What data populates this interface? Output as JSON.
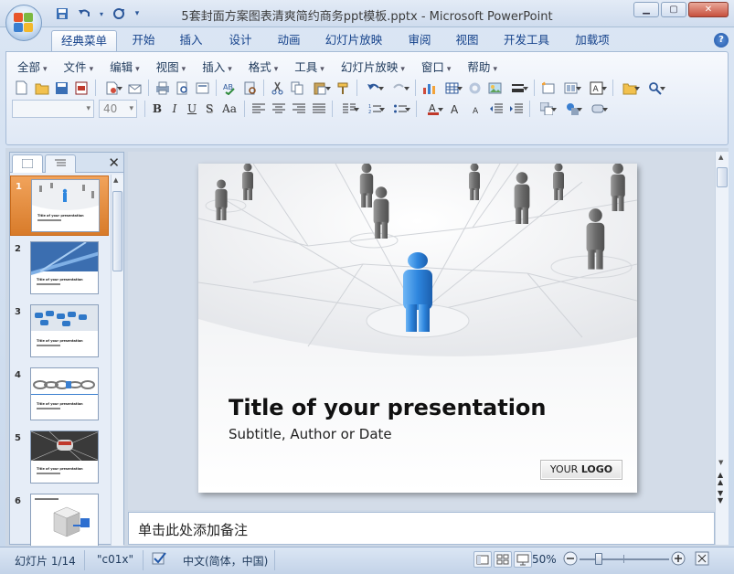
{
  "window": {
    "title": "5套封面方案图表清爽简约商务ppt模板.pptx - Microsoft PowerPoint"
  },
  "tabs": [
    "经典菜单",
    "开始",
    "插入",
    "设计",
    "动画",
    "幻灯片放映",
    "审阅",
    "视图",
    "开发工具",
    "加载项"
  ],
  "menus": [
    "全部",
    "文件",
    "编辑",
    "视图",
    "插入",
    "格式",
    "工具",
    "幻灯片放映",
    "窗口",
    "帮助"
  ],
  "font": {
    "name": "",
    "size": "40"
  },
  "format_buttons": {
    "bold": "B",
    "italic": "I",
    "underline": "U",
    "shadow": "S",
    "case": "Aa"
  },
  "thumbnails": [
    {
      "num": "1",
      "theme": "people",
      "text": "Title of your presentation"
    },
    {
      "num": "2",
      "theme": "blue",
      "text": "Title of your presentation"
    },
    {
      "num": "3",
      "theme": "cables",
      "text": "Title of your presentation"
    },
    {
      "num": "4",
      "theme": "chain",
      "text": "Title of your presentation"
    },
    {
      "num": "5",
      "theme": "train",
      "text": "Title of your presentation"
    },
    {
      "num": "6",
      "theme": "cubes",
      "text": ""
    }
  ],
  "slide": {
    "title": "Title of your presentation",
    "subtitle": "Subtitle, Author or Date",
    "logo_prefix": "YOUR",
    "logo_bold": "LOGO"
  },
  "notes": {
    "placeholder": "单击此处添加备注"
  },
  "status": {
    "slide": "幻灯片 1/14",
    "theme": "\"c01x\"",
    "language": "中文(简体，中国)",
    "zoom": "50%",
    "zoom_level": 0.5
  },
  "colors": {
    "accent": "#f0a050",
    "figure_blue": "#2e86de"
  }
}
